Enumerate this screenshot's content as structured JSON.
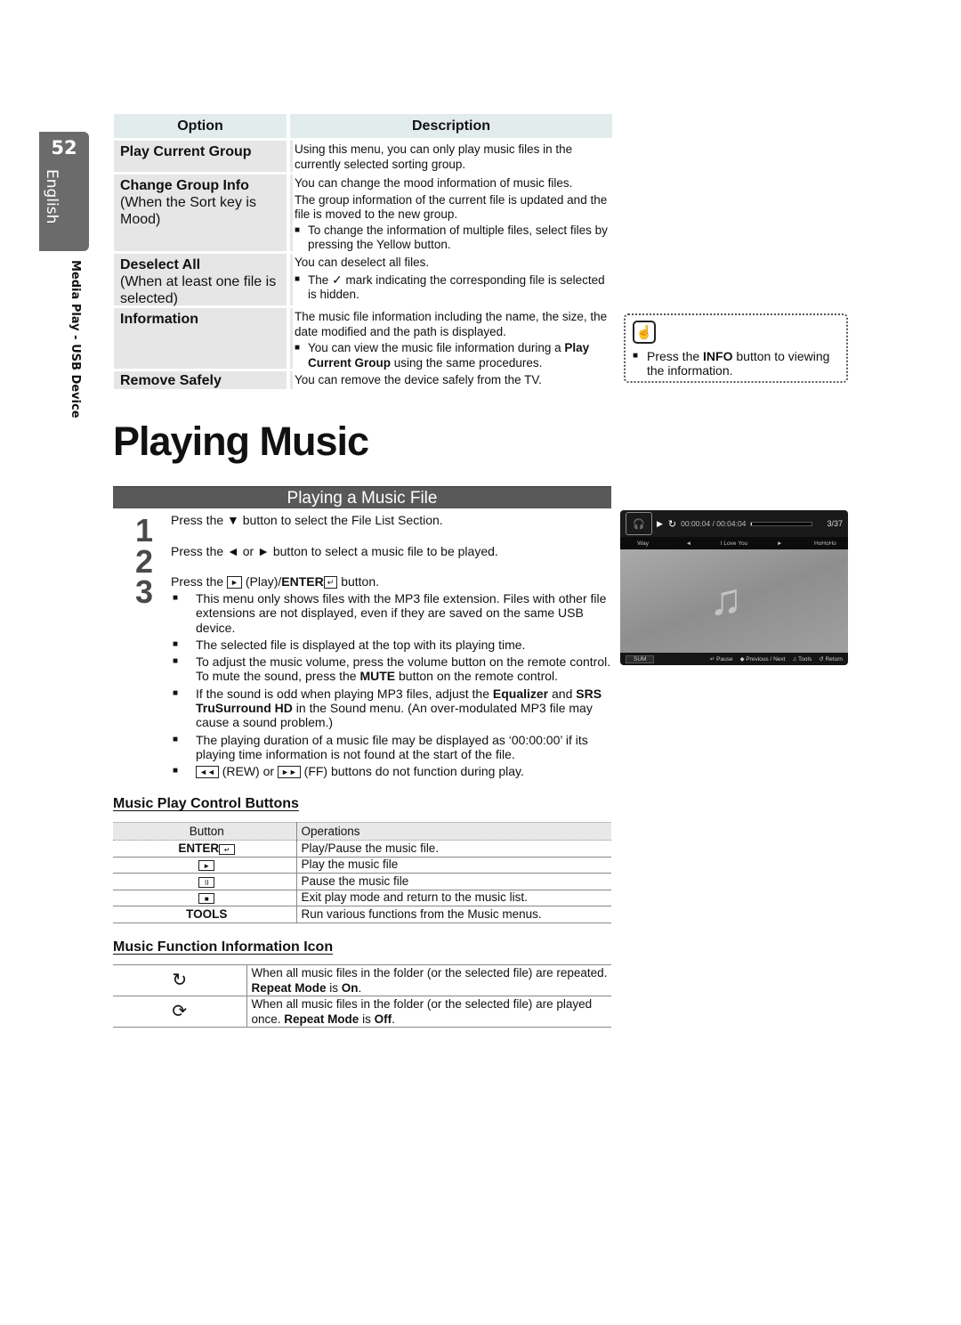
{
  "side": {
    "page_number": "52",
    "language": "English",
    "section": "Media Play - USB Device"
  },
  "option_table": {
    "headers": [
      "Option",
      "Description"
    ],
    "rows": [
      {
        "name": "Play Current Group",
        "condition": "",
        "description": "Using this menu, you can only play music files in the currently selected sorting group.",
        "bullet": ""
      },
      {
        "name": "Change Group Info",
        "condition": "(When the Sort key is Mood)",
        "description": "You can change the mood information of music files.",
        "description2": "The group information of the current file is updated and the file is moved to the new group.",
        "bullet": "To change the information of multiple files, select files by pressing the Yellow button."
      },
      {
        "name": "Deselect All",
        "condition": "(When at least one file is selected)",
        "description": "You can deselect all files.",
        "bullet_pre": "The",
        "bullet_icon": "checkmark-icon",
        "bullet_post": "mark indicating the corresponding file is selected is hidden."
      },
      {
        "name": "Information",
        "condition": "",
        "description": "The music file information including the name, the size, the date modified and the path is displayed.",
        "bullet_pre": "You can view the music file information during a",
        "bullet_bold": "Play Current Group",
        "bullet_post": "using the same procedures."
      },
      {
        "name": "Remove Safely",
        "condition": "",
        "description": "You can remove the device safely from the TV."
      }
    ]
  },
  "note": {
    "icon": "hand-pointer-icon",
    "pre": "Press the",
    "bold": "INFO",
    "post": "button to viewing the information."
  },
  "main_title": "Playing Music",
  "section_bar": "Playing a Music File",
  "steps": [
    {
      "num": "1",
      "text": "Press the ▼ button to select the File List Section."
    },
    {
      "num": "2",
      "text": "Press the ◄ or ► button to select a music file to be played."
    },
    {
      "num": "3",
      "pre": "Press the",
      "key": "►",
      "mid": "(Play)/",
      "bold": "ENTER",
      "enter_icon": "↵",
      "post": "button."
    }
  ],
  "step3_notes": [
    {
      "text": "This menu only shows files with the MP3 file extension. Files with other file extensions are not displayed, even if they are saved on the same USB device."
    },
    {
      "text": "The selected file is displayed at the top with its playing time."
    },
    {
      "pre": "To adjust the music volume, press the volume button on the remote control. To mute the sound, press the",
      "bold": "MUTE",
      "post": "button on the remote control."
    },
    {
      "pre": "If the sound is odd when playing MP3 files, adjust the",
      "bold": "Equalizer",
      "mid": "and",
      "bold2": "SRS TruSurround HD",
      "post": "in the Sound menu. (An over-modulated MP3 file may cause a sound problem.)"
    },
    {
      "text": "The playing duration of a music file may be displayed as ‘00:00:00’ if its playing time information is not found at the start of the file."
    },
    {
      "rew_key": "◄◄",
      "rew": "(REW) or",
      "ff_key": "►►",
      "post": "(FF) buttons do not function during play."
    }
  ],
  "tv_screen": {
    "time": "00:00:04 / 00:04:04",
    "progress_fraction": 0.016,
    "count": "3/37",
    "prev_track": "Way",
    "current_track": "I Love You",
    "next_track": "HoHoHo",
    "sum_label": "SUM",
    "pause_label": "Pause",
    "prevnext_label": "Previous / Next",
    "tools_label": "Tools",
    "return_label": "Return"
  },
  "control_section": {
    "heading": "Music Play Control Buttons",
    "headers": [
      "Button",
      "Operations"
    ],
    "rows": [
      {
        "button": "ENTER",
        "button_icon": "↵",
        "operation": "Play/Pause the music file."
      },
      {
        "button_key": "►",
        "operation": "Play the music file"
      },
      {
        "button_key": "II",
        "operation": "Pause the music file"
      },
      {
        "button_key": "■",
        "operation": "Exit play mode and return to the music list."
      },
      {
        "button": "TOOLS",
        "operation": "Run various functions from the Music menus."
      }
    ]
  },
  "icon_section": {
    "heading": "Music Function Information Icon",
    "rows": [
      {
        "icon": "↻",
        "pre": "When all music files in the folder (or the selected file) are repeated.",
        "bold": "Repeat Mode",
        "mid": "is",
        "bold2": "On",
        "post": "."
      },
      {
        "icon": "⟳",
        "pre": "When all music files in the folder (or the selected file) are played once.",
        "bold": "Repeat Mode",
        "mid": "is",
        "bold2": "Off",
        "post": "."
      }
    ]
  }
}
